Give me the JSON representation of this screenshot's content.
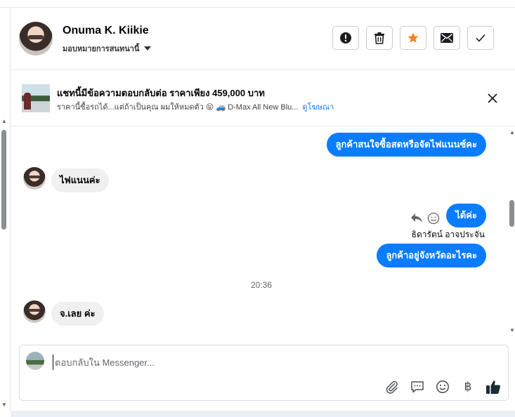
{
  "header": {
    "name": "Onuma K. Kiikie",
    "assign_label": "มอบหมายการสนทนานี้",
    "buttons": {
      "spam_icon": "exclamation-circle-icon",
      "trash_icon": "trash-icon",
      "star_icon": "star-icon",
      "mail_icon": "envelope-icon",
      "done_icon": "checkmark-icon"
    },
    "star_color": "#f5831f"
  },
  "ad": {
    "title": "แชทนี้มีข้อความตอบกลับต่อ ราคาเพียง 459,000 บาท",
    "subtitle": "ราคานี้ซื้อรถได้...แต่ถ้าเป็นคุณ ผมให้หมดตัว 😝 🚙 D-Max All New Blu...",
    "link": "ดูโฆษณา"
  },
  "messages": {
    "m1": "ลูกค้าสนใจซื้อสดหรือจัดไฟแนนซ์คะ",
    "m2": "ไฟแนนค่ะ",
    "m3": "ได้ค่ะ",
    "m3_sender": "ธิดารัตน์ อาจประจัน",
    "m4": "ลูกค้าอยู่จังหวัดอะไรคะ",
    "time": "20:36",
    "m5": "จ.เลย ค่ะ"
  },
  "composer": {
    "placeholder": "ตอบกลับใน Messenger...",
    "tools": [
      "paperclip-icon",
      "chat-bubble-icon",
      "smiley-icon",
      "baht-icon",
      "thumbs-up-icon"
    ],
    "baht_symbol": "฿"
  },
  "colors": {
    "outgoing_bubble": "#0a7cff",
    "incoming_bubble": "#f0f0f0",
    "link": "#1877f2"
  }
}
